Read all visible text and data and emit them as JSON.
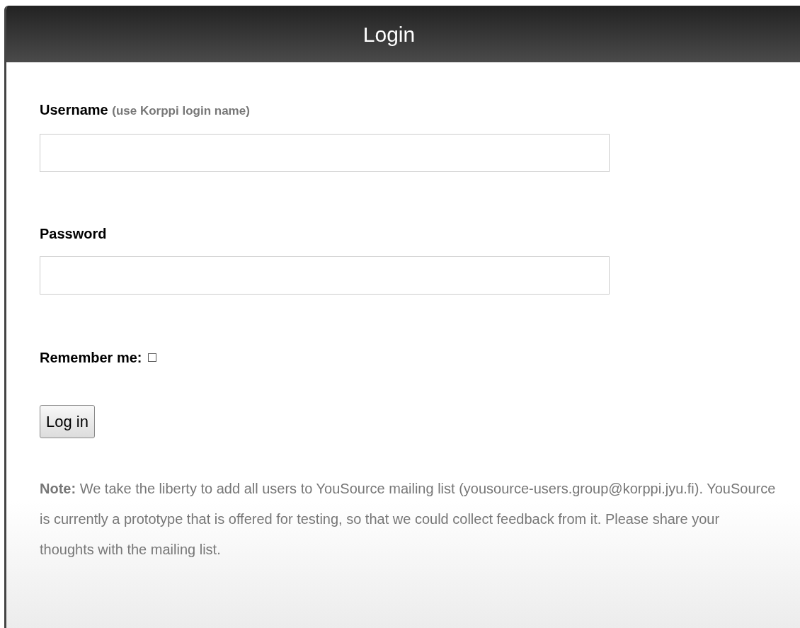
{
  "header": {
    "title": "Login"
  },
  "form": {
    "username": {
      "label": "Username",
      "hint": "(use Korppi login name)"
    },
    "password": {
      "label": "Password"
    },
    "remember": {
      "label": "Remember me:",
      "checked": false
    },
    "submit": {
      "label": "Log in"
    },
    "note": "**Note:** We take the liberty to add all users to YouSource mailing list (yousource-users.group@korppi.jyu.fi). YouSource is currently a prototype that is offered for testing, so that we could collect feedback from it. Please share your thoughts with the mailing list."
  }
}
